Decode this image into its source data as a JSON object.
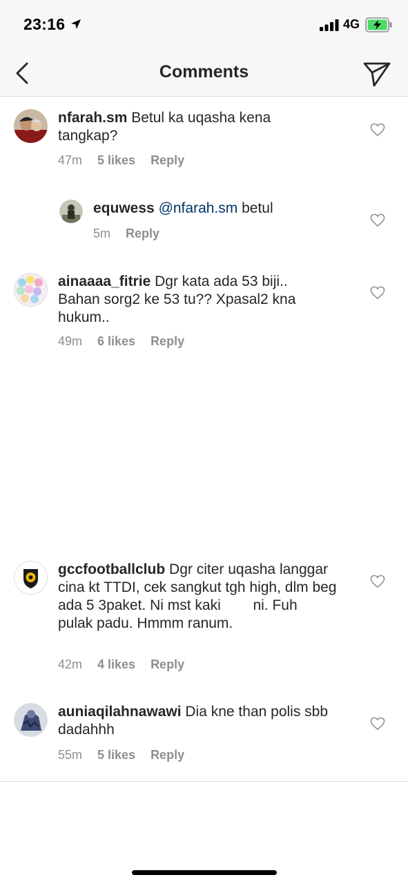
{
  "status": {
    "time": "23:16",
    "network": "4G"
  },
  "header": {
    "title": "Comments"
  },
  "comments": [
    {
      "username": "nfarah.sm",
      "text": "Betul ka uqasha kena tangkap?",
      "time": "47m",
      "likes": "5 likes",
      "reply": "Reply"
    },
    {
      "username": "equwess",
      "mention": "@nfarah.sm",
      "text": "betul",
      "time": "5m",
      "reply": "Reply"
    },
    {
      "username": "ainaaaa_fitrie",
      "text": "Dgr kata ada 53 biji.. Bahan sorg2 ke 53 tu?? Xpasal2 kna hukum..",
      "time": "49m",
      "likes": "6 likes",
      "reply": "Reply"
    },
    {
      "username": "gccfootballclub",
      "text": "Dgr citer uqasha langgar cina kt TTDI, cek sangkut tgh high, dlm beg ada 5 3paket. Ni mst kaki        ni. Fuh         pulak padu. Hmmm ranum.",
      "time": "42m",
      "likes": "4 likes",
      "reply": "Reply"
    },
    {
      "username": "auniaqilahnawawi",
      "text": "Dia kne than polis sbb dadahhh",
      "time": "55m",
      "likes": "5 likes",
      "reply": "Reply"
    }
  ],
  "icons": {
    "back": "chevron-left-icon",
    "share": "paper-plane-icon",
    "like": "heart-icon"
  }
}
